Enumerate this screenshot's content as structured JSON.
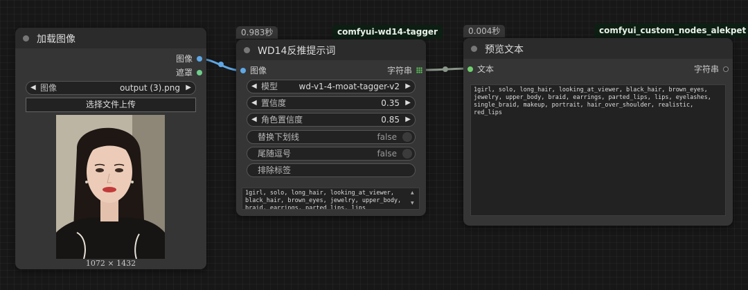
{
  "colors": {
    "image_link": "#5fa8e6",
    "string_link": "#8a968a",
    "image_dot": "#5fa8e6",
    "mask_dot": "#6fcf8c",
    "string_dot_out": "#6fcf6f",
    "text_dot_in": "#6fcf6f"
  },
  "load_image": {
    "title": "加载图像",
    "out_image": "图像",
    "out_mask": "遮罩",
    "image_widget": {
      "label": "图像",
      "value": "output (3).png"
    },
    "upload_button": "选择文件上传",
    "dimensions": "1072 × 1432"
  },
  "tagger": {
    "time": "0.983秒",
    "source": "comfyui-wd14-tagger",
    "title": "WD14反推提示词",
    "in_image": "图像",
    "out_string": "字符串",
    "model": {
      "label": "模型",
      "value": "wd-v1-4-moat-tagger-v2"
    },
    "threshold": {
      "label": "置信度",
      "value": "0.35"
    },
    "character_threshold": {
      "label": "角色置信度",
      "value": "0.85"
    },
    "replace_underscore": {
      "label": "替换下划线",
      "value": "false"
    },
    "trailing_comma": {
      "label": "尾随逗号",
      "value": "false"
    },
    "exclude_tags": {
      "label": "排除标签"
    },
    "output_text": "1girl, solo, long_hair, looking_at_viewer, black_hair, brown_eyes, jewelry, upper_body, braid, earrings, parted_lips, lips"
  },
  "preview": {
    "time": "0.004秒",
    "source": "comfyui_custom_nodes_alekpet",
    "title": "预览文本",
    "in_text": "文本",
    "out_string": "字符串",
    "text": "1girl, solo, long_hair, looking_at_viewer, black_hair, brown_eyes, jewelry, upper_body, braid, earrings, parted_lips, lips, eyelashes, single_braid, makeup, portrait, hair_over_shoulder, realistic, red_lips"
  }
}
